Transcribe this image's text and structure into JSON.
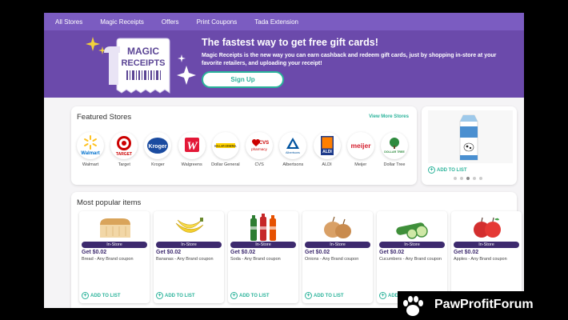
{
  "nav": {
    "items": [
      "All Stores",
      "Magic Receipts",
      "Offers",
      "Print Coupons",
      "Tada Extension"
    ]
  },
  "hero": {
    "logo_line1": "MAGIC",
    "logo_line2": "RECEIPTS",
    "title": "The fastest way to get free gift cards!",
    "description": "Magic Receipts is the new way you can earn cashback and redeem gift cards, just by shopping in-store at your favorite retailers, and uploading your receipt!",
    "signup_label": "Sign Up"
  },
  "featured": {
    "title": "Featured Stores",
    "view_more": "View More Stores",
    "stores": [
      {
        "name": "Walmart",
        "logo_text": "Walmart"
      },
      {
        "name": "Target",
        "logo_text": "TARGET"
      },
      {
        "name": "Kroger",
        "logo_text": "Kroger"
      },
      {
        "name": "Walgreens",
        "logo_text": "W"
      },
      {
        "name": "Dollar General",
        "logo_text": "DOLLAR GENERAL"
      },
      {
        "name": "CVS",
        "logo_text": "CVS",
        "logo_text2": "pharmacy"
      },
      {
        "name": "Albertsons",
        "logo_text": "Albertsons"
      },
      {
        "name": "ALDI",
        "logo_text": "ALDI"
      },
      {
        "name": "Meijer",
        "logo_text": "meijer"
      },
      {
        "name": "Dollar Tree",
        "logo_text": "DOLLAR TREE"
      }
    ]
  },
  "promo": {
    "add_label": "ADD TO LIST",
    "slides": 5,
    "active_slide": 3
  },
  "popular": {
    "title": "Most popular items",
    "badge": "In-Store",
    "add_label": "ADD TO LIST",
    "items": [
      {
        "price": "Get $0.02",
        "desc": "Bread - Any Brand coupon"
      },
      {
        "price": "Get $0.02",
        "desc": "Bananas - Any Brand coupon"
      },
      {
        "price": "Get $0.02",
        "desc": "Soda - Any Brand coupon"
      },
      {
        "price": "Get $0.02",
        "desc": "Onions - Any Brand coupon"
      },
      {
        "price": "Get $0.02",
        "desc": "Cucumbers - Any Brand coupon"
      },
      {
        "price": "Get $0.02",
        "desc": "Apples - Any Brand coupon"
      }
    ]
  },
  "watermark": {
    "text": "PawProfitForum"
  },
  "colors": {
    "nav_bg": "#7b5cc1",
    "hero_bg": "#6b4aab",
    "accent_green": "#2ab39a",
    "badge_purple": "#3d2a6e"
  }
}
